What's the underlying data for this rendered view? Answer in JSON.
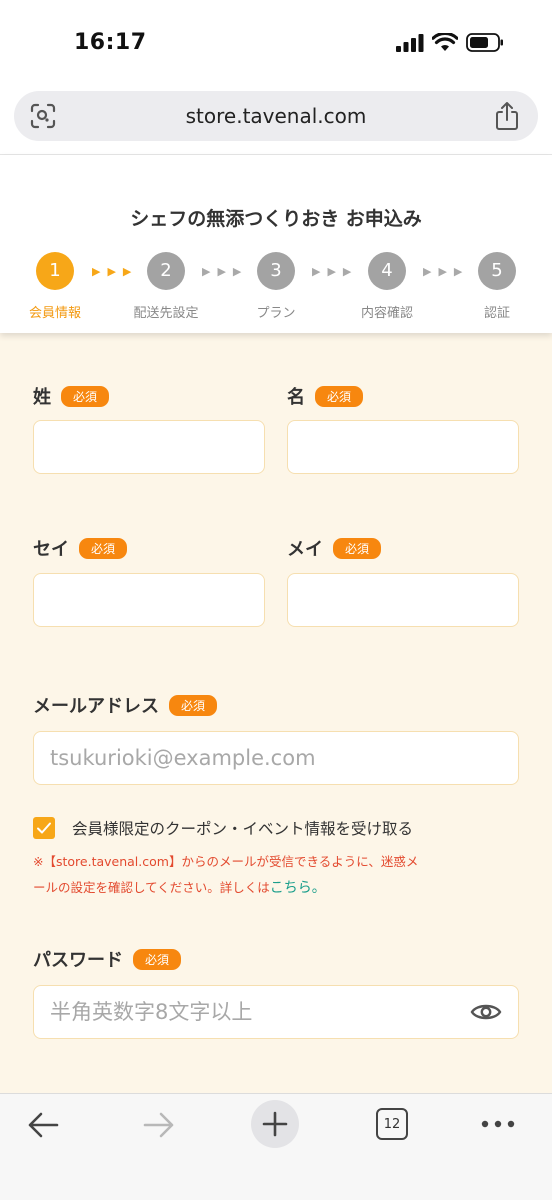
{
  "status_bar": {
    "time": "16:17"
  },
  "browser": {
    "url": "store.tavenal.com",
    "tab_count": "12"
  },
  "form": {
    "title": "シェフの無添つくりおき お申込み",
    "steps": [
      {
        "number": "1",
        "label": "会員情報"
      },
      {
        "number": "2",
        "label": "配送先設定"
      },
      {
        "number": "3",
        "label": "プラン"
      },
      {
        "number": "4",
        "label": "内容確認"
      },
      {
        "number": "5",
        "label": "認証"
      }
    ],
    "arrow_glyphs": "▶▶▶",
    "required_badge": "必須",
    "fields": {
      "last_name": {
        "label": "姓",
        "value": ""
      },
      "first_name": {
        "label": "名",
        "value": ""
      },
      "last_name_kana": {
        "label": "セイ",
        "value": ""
      },
      "first_name_kana": {
        "label": "メイ",
        "value": ""
      },
      "email": {
        "label": "メールアドレス",
        "placeholder": "tsukurioki@example.com"
      },
      "password": {
        "label": "パスワード",
        "placeholder": "半角英数字8文字以上"
      }
    },
    "newsletter": {
      "checked": true,
      "label": "会員様限定のクーポン・イベント情報を受け取る"
    },
    "notice_line1": "※【store.tavenal.com】からのメールが受信できるように、迷惑メ",
    "notice_line2": "ールの設定を確認してください。詳しくは",
    "notice_link": "こちら。"
  },
  "colors": {
    "accent": "#f7a718",
    "badge": "#f7870f",
    "inactive_step": "#a3a3a3",
    "form_bg": "#fdf6e8",
    "notice": "#e34a2f",
    "link": "#1a9e8b"
  },
  "icons": {
    "signal": "signal-icon",
    "wifi": "wifi-icon",
    "battery": "battery-icon",
    "lens": "lens-icon",
    "share": "share-icon",
    "eye": "eye-icon",
    "back": "back-arrow-icon",
    "forward": "forward-arrow-icon",
    "new_tab": "plus-icon",
    "tabs": "tabs-icon",
    "more": "more-icon"
  }
}
